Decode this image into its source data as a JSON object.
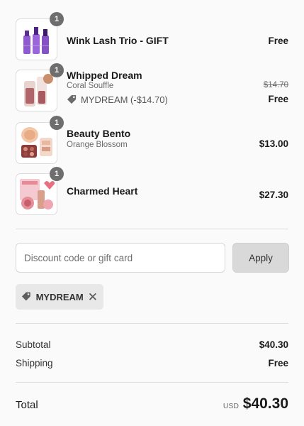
{
  "items": [
    {
      "name": "Wink Lash Trio - GIFT",
      "quantity": "1",
      "price": "Free",
      "image_icon": "lash-tubes-icon"
    },
    {
      "name": "Whipped Dream",
      "variant": "Coral Souffle",
      "discount_label": "MYDREAM (-$14.70)",
      "original_price": "$14.70",
      "price": "Free",
      "quantity": "1",
      "image_icon": "lip-tint-icon"
    },
    {
      "name": "Beauty Bento",
      "variant": "Orange Blossom",
      "quantity": "1",
      "price": "$13.00",
      "image_icon": "palette-icon"
    },
    {
      "name": "Charmed Heart",
      "quantity": "1",
      "price": "$27.30",
      "image_icon": "gift-set-icon"
    }
  ],
  "discount": {
    "placeholder": "Discount code or gift card",
    "value": "",
    "apply_label": "Apply",
    "applied_code": "MYDREAM",
    "remove_symbol": "✕"
  },
  "summary": {
    "subtotal_label": "Subtotal",
    "subtotal_value": "$40.30",
    "shipping_label": "Shipping",
    "shipping_value": "Free",
    "total_label": "Total",
    "currency": "USD",
    "total_value": "$40.30"
  }
}
